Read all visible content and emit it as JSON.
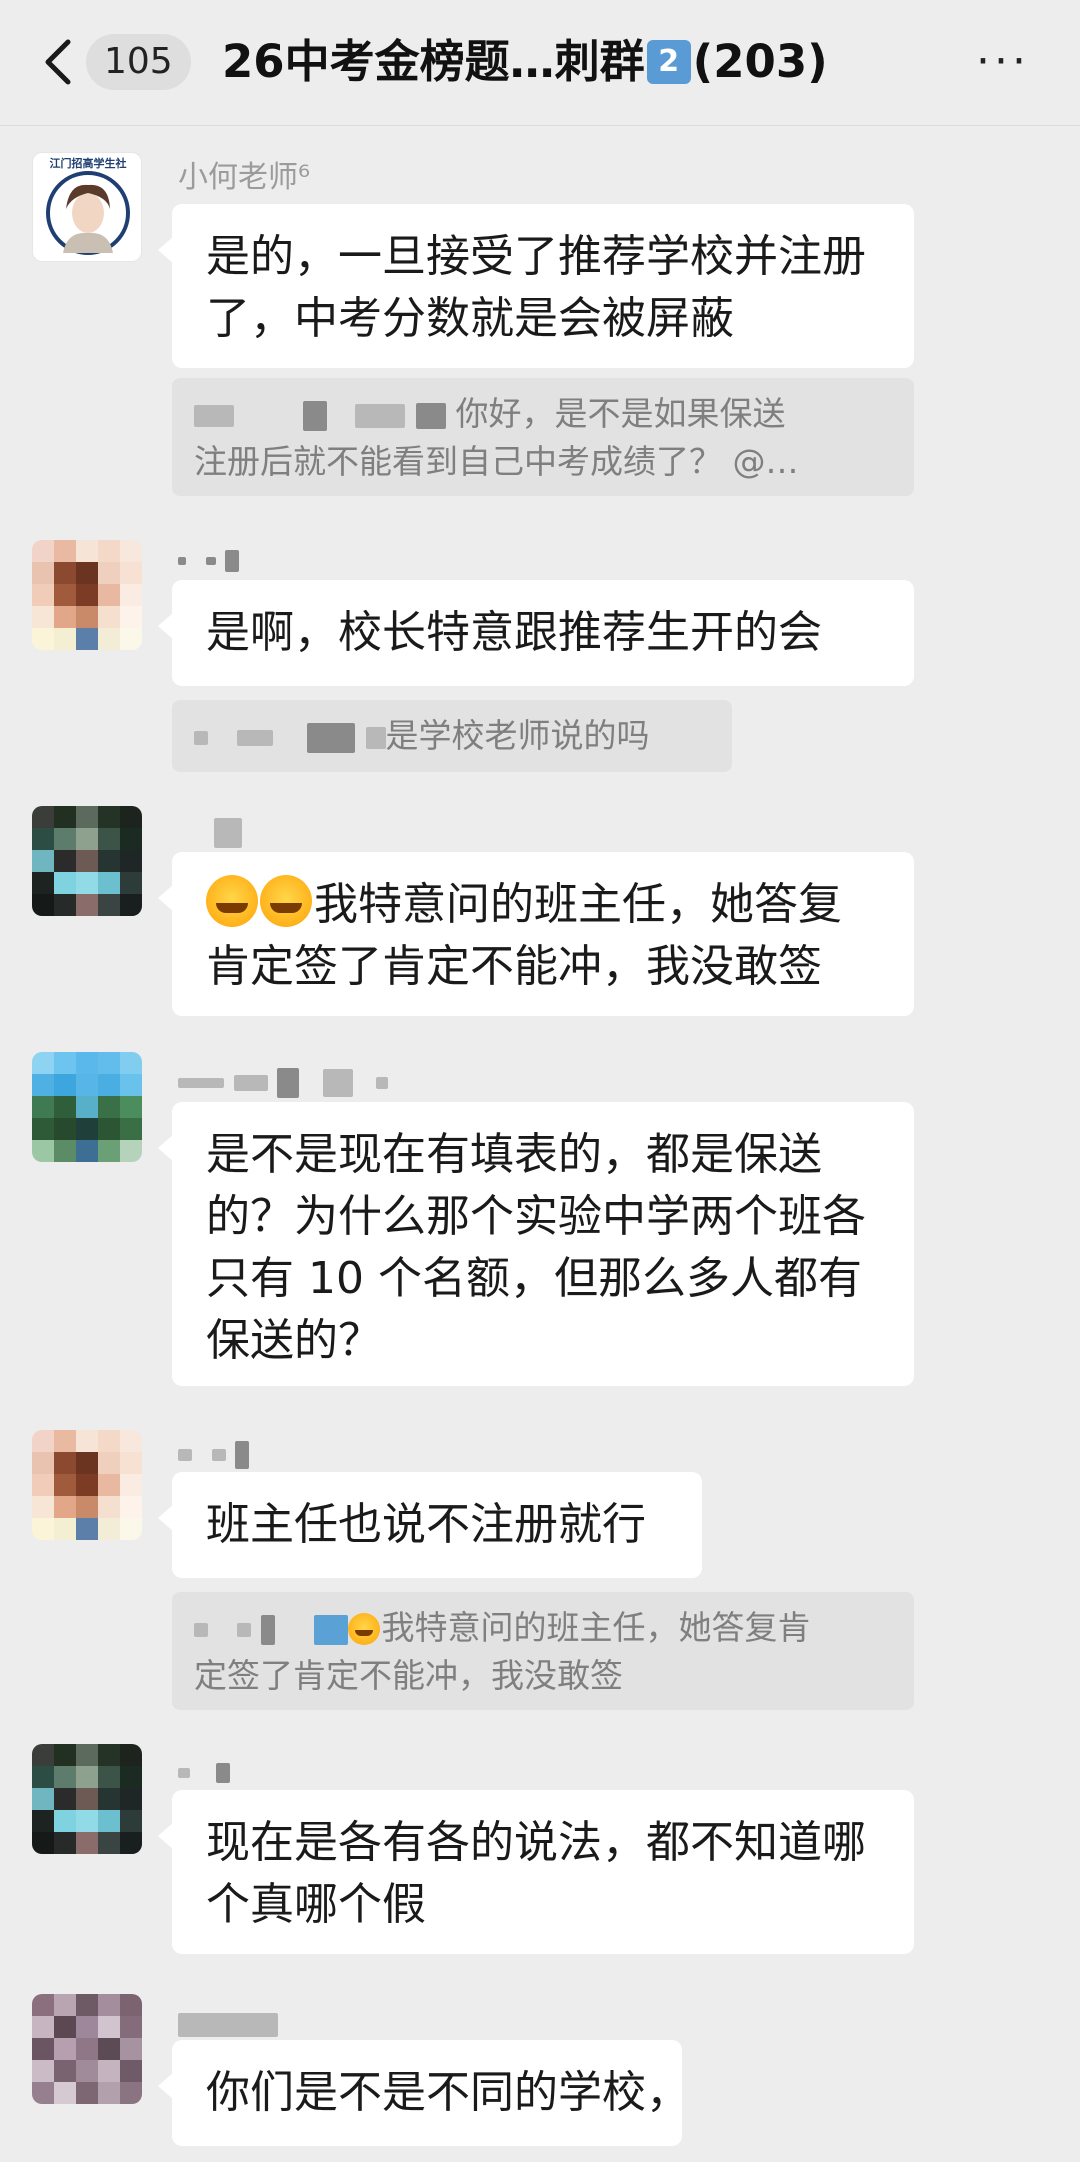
{
  "header": {
    "unread_count": "105",
    "title_pre": "26中考金榜题…刺群",
    "title_badge": "2",
    "title_post": "(203)",
    "more_label": "···"
  },
  "messages": [
    {
      "sender": "小何老师⁶",
      "avatar_text": "江门招高学生社",
      "text": "是的，一旦接受了推荐学校并注册了，中考分数就是会被屏蔽",
      "quote": {
        "line1": "你好，是不是如果保送",
        "line2": "注册后就不能看到自己中考成绩了？ @…"
      }
    },
    {
      "text": "是啊，校长特意跟推荐生开的会",
      "quote": {
        "line1": "是学校老师说的吗"
      }
    },
    {
      "text_line1": "我特意问的班主任，她答复",
      "text_line2": "肯定签了肯定不能冲，我没敢签"
    },
    {
      "text": "是不是现在有填表的，都是保送的？为什么那个实验中学两个班各只有 10 个名额，但那么多人都有保送的？"
    },
    {
      "text": "班主任也说不注册就行",
      "quote": {
        "line1": "我特意问的班主任，她答复肯",
        "line2": "定签了肯定不能冲，我没敢签"
      }
    },
    {
      "text": "现在是各有各的说法，都不知道哪个真哪个假"
    },
    {
      "text": "你们是不是不同的学校，"
    }
  ]
}
